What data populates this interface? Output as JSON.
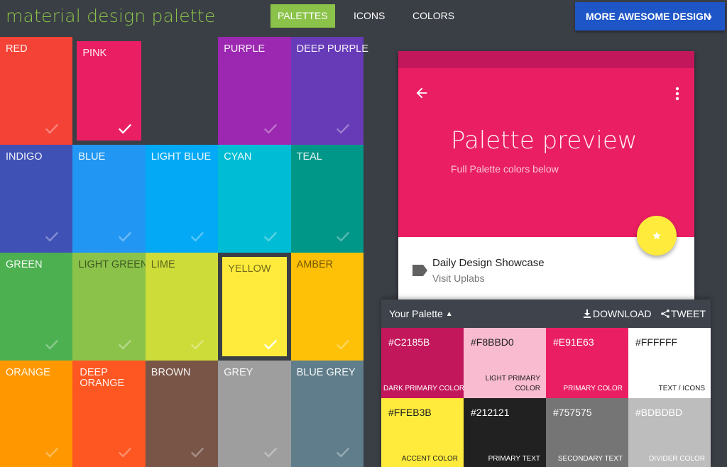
{
  "header": {
    "logo": "material design palette",
    "tabs": [
      {
        "label": "PALETTES",
        "active": true
      },
      {
        "label": "ICONS",
        "active": false
      },
      {
        "label": "COLORS",
        "active": false
      }
    ],
    "more_button": "MORE AWESOME DESIGN",
    "accent": "#8bc34a",
    "button_color": "#1e56c7"
  },
  "palettes": [
    {
      "label": "RED",
      "color": "#f44336"
    },
    {
      "label": "PINK",
      "color": "#e91e63"
    },
    {
      "label": "",
      "color": "#3a3e45"
    },
    {
      "label": "PURPLE",
      "color": "#9c27b0"
    },
    {
      "label": "DEEP PURPLE",
      "color": "#673ab7"
    },
    {
      "label": "INDIGO",
      "color": "#3f51b5"
    },
    {
      "label": "BLUE",
      "color": "#2196f3"
    },
    {
      "label": "LIGHT BLUE",
      "color": "#03a9f4"
    },
    {
      "label": "CYAN",
      "color": "#00bcd4"
    },
    {
      "label": "TEAL",
      "color": "#009688"
    },
    {
      "label": "GREEN",
      "color": "#4caf50"
    },
    {
      "label": "LIGHT GREEN",
      "color": "#8bc34a"
    },
    {
      "label": "LIME",
      "color": "#cddc39"
    },
    {
      "label": "YELLOW",
      "color": "#ffeb3b"
    },
    {
      "label": "AMBER",
      "color": "#ffc107"
    },
    {
      "label": "ORANGE",
      "color": "#ff9800"
    },
    {
      "label": "DEEP ORANGE",
      "color": "#ff5722"
    },
    {
      "label": "BROWN",
      "color": "#795548"
    },
    {
      "label": "GREY",
      "color": "#9e9e9e"
    },
    {
      "label": "BLUE GREY",
      "color": "#607d8b"
    }
  ],
  "preview": {
    "title": "Palette preview",
    "subtitle": "Full Palette colors below",
    "list_title": "Daily Design Showcase",
    "list_subtitle": "Visit Uplabs",
    "icons": {
      "back": "arrow-back-icon",
      "more": "more-vert-icon",
      "fab": "star-icon",
      "list": "label-icon"
    }
  },
  "your_palette": {
    "title": "Your Palette",
    "download": "DOWNLOAD",
    "tweet": "TWEET",
    "swatches": [
      {
        "hex": "#C2185B",
        "role": "DARK PRIMARY COLOR",
        "bg": "#c2185b",
        "fg": "#ffffff"
      },
      {
        "hex": "#F8BBD0",
        "role": "LIGHT PRIMARY COLOR",
        "bg": "#f8bbd0",
        "fg": "#212121"
      },
      {
        "hex": "#E91E63",
        "role": "PRIMARY COLOR",
        "bg": "#e91e63",
        "fg": "#ffffff"
      },
      {
        "hex": "#FFFFFF",
        "role": "TEXT / ICONS",
        "bg": "#ffffff",
        "fg": "#212121"
      },
      {
        "hex": "#FFEB3B",
        "role": "ACCENT COLOR",
        "bg": "#ffeb3b",
        "fg": "#212121"
      },
      {
        "hex": "#212121",
        "role": "PRIMARY TEXT",
        "bg": "#212121",
        "fg": "#ffffff"
      },
      {
        "hex": "#757575",
        "role": "SECONDARY TEXT",
        "bg": "#757575",
        "fg": "#ffffff"
      },
      {
        "hex": "#BDBDBD",
        "role": "DIVIDER COLOR",
        "bg": "#bdbdbd",
        "fg": "#ffffff"
      }
    ]
  }
}
